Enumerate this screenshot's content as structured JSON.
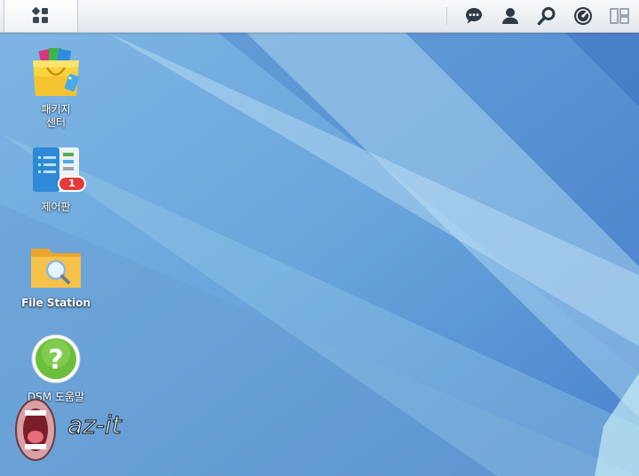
{
  "taskbar": {
    "main_menu_icon": "grid-icon",
    "right_icons": [
      "chat-icon",
      "user-icon",
      "search-icon",
      "dashboard-icon",
      "widgets-icon"
    ]
  },
  "desktop": {
    "shortcuts": [
      {
        "label_lines": [
          "패키지",
          "센터"
        ],
        "icon": "package-center-icon"
      },
      {
        "label": "제어판",
        "icon": "control-panel-icon",
        "badge": "1"
      },
      {
        "label": "File Station",
        "icon": "file-station-icon"
      },
      {
        "label": "DSM 도움말",
        "icon": "dsm-help-icon"
      }
    ]
  },
  "watermark": {
    "text": "az-it",
    "icon": "mouth-logo"
  },
  "colors": {
    "badge": "#e53a3a",
    "desktop": "#5e95d0",
    "help_green": "#6cbf3a",
    "folder": "#f2b43b"
  }
}
